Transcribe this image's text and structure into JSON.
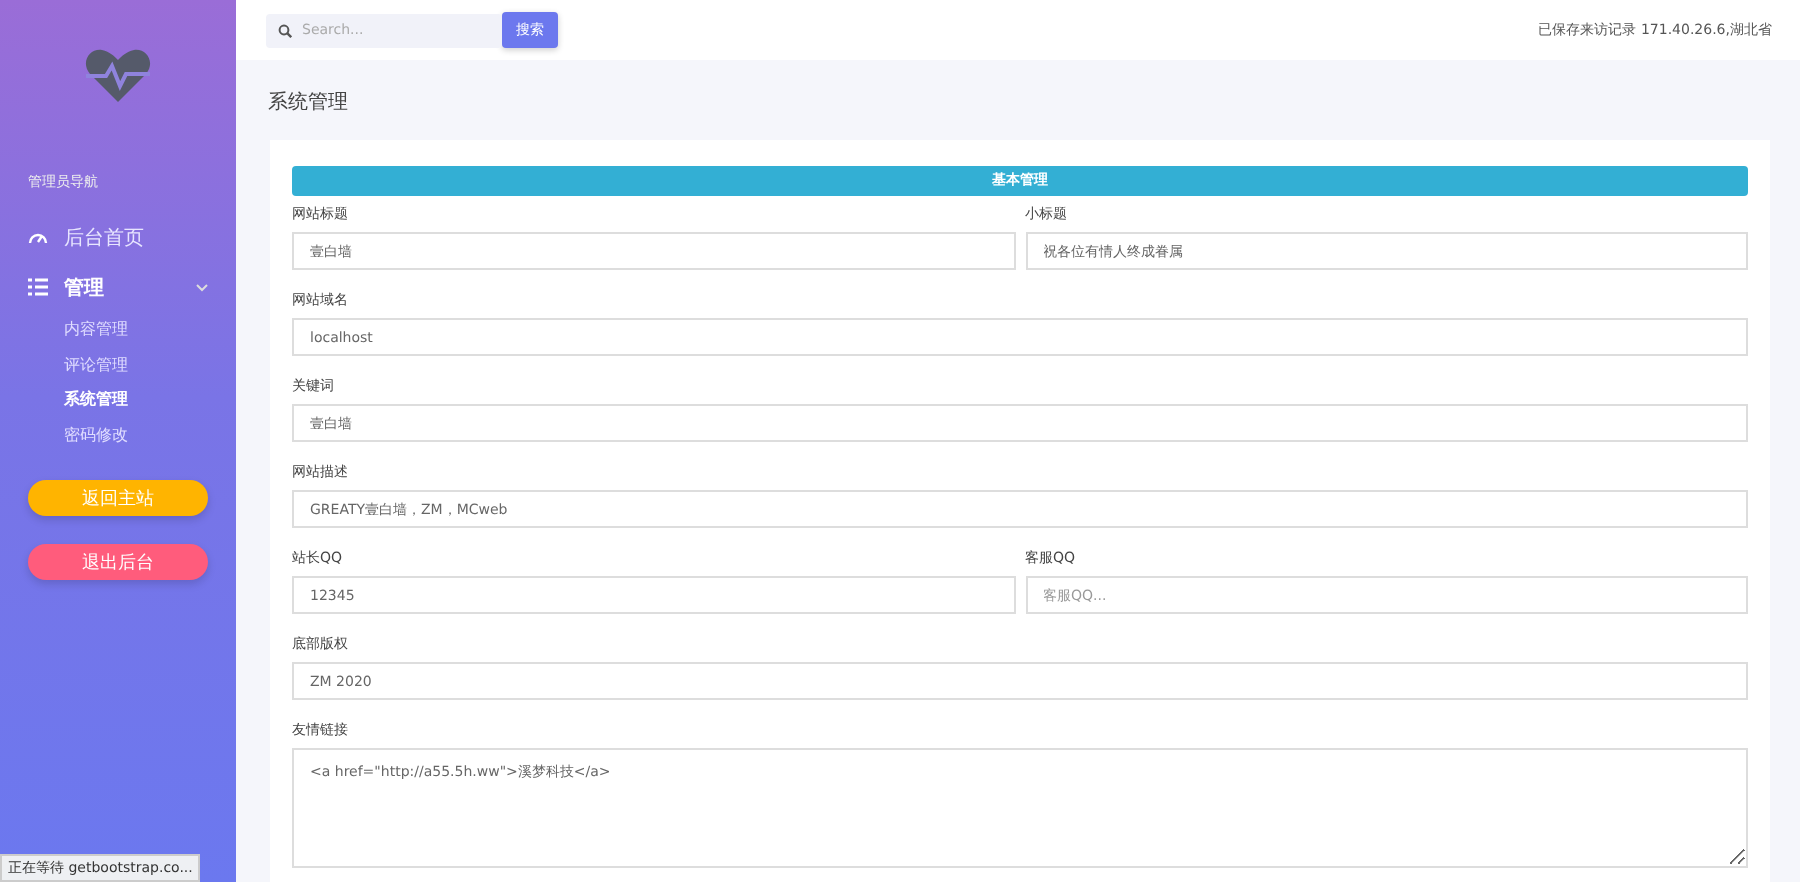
{
  "sidebar": {
    "section_label": "管理员导航",
    "nav": [
      {
        "kind": "link",
        "label": "后台首页"
      },
      {
        "kind": "group",
        "label": "管理",
        "expanded": true,
        "children": [
          {
            "label": "内容管理",
            "selected": false
          },
          {
            "label": "评论管理",
            "selected": false
          },
          {
            "label": "系统管理",
            "selected": true
          },
          {
            "label": "密码修改",
            "selected": false
          }
        ]
      }
    ],
    "buttons": [
      {
        "label": "返回主站",
        "color": "#ffb400"
      },
      {
        "label": "退出后台",
        "color": "#ff5c7c"
      }
    ]
  },
  "topbar": {
    "search": {
      "placeholder": "Search..."
    },
    "search_button": "搜索",
    "visitor_info": "已保存来访记录 171.40.26.6,湖北省"
  },
  "page_title": "系统管理",
  "form": {
    "section_header": "基本管理",
    "rows": [
      [
        {
          "kind": "input",
          "label": "网站标题",
          "value": "壹白墙"
        },
        {
          "kind": "input",
          "label": "小标题",
          "value": "祝各位有情人终成眷属"
        }
      ],
      [
        {
          "kind": "input",
          "label": "网站域名",
          "value": "localhost"
        }
      ],
      [
        {
          "kind": "input",
          "label": "关键词",
          "value": "壹白墙"
        }
      ],
      [
        {
          "kind": "input",
          "label": "网站描述",
          "value": "GREATY壹白墙，ZM，MCweb"
        }
      ],
      [
        {
          "kind": "input",
          "label": "站长QQ",
          "value": "12345"
        },
        {
          "kind": "input",
          "label": "客服QQ",
          "placeholder": "客服QQ..."
        }
      ],
      [
        {
          "kind": "input",
          "label": "底部版权",
          "value": "ZM 2020"
        }
      ],
      [
        {
          "kind": "textarea",
          "label": "友情链接",
          "value": "<a href=\"http://a55.5h.ww\">溪梦科技</a>"
        }
      ]
    ]
  },
  "status_tooltip": "正在等待 getbootstrap.co..."
}
